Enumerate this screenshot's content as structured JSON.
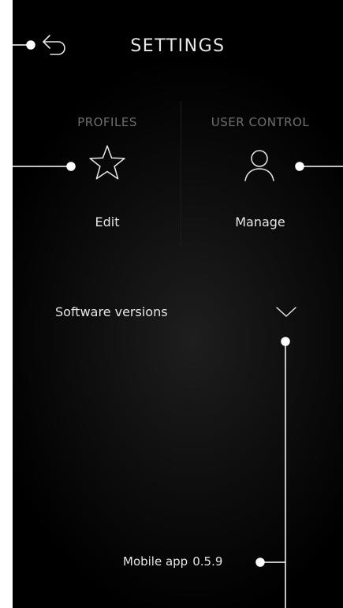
{
  "header": {
    "title": "SETTINGS"
  },
  "profiles": {
    "section_label": "PROFILES",
    "action_label": "Edit"
  },
  "user_control": {
    "section_label": "USER CONTROL",
    "action_label": "Manage"
  },
  "software": {
    "label": "Software versions",
    "items": [
      {
        "name": "Mobile app",
        "version": "0.5.9"
      }
    ]
  },
  "colors": {
    "background": "#000000",
    "text": "#e6e6e6",
    "muted": "#6f6f6f",
    "annotation": "#ffffff"
  }
}
